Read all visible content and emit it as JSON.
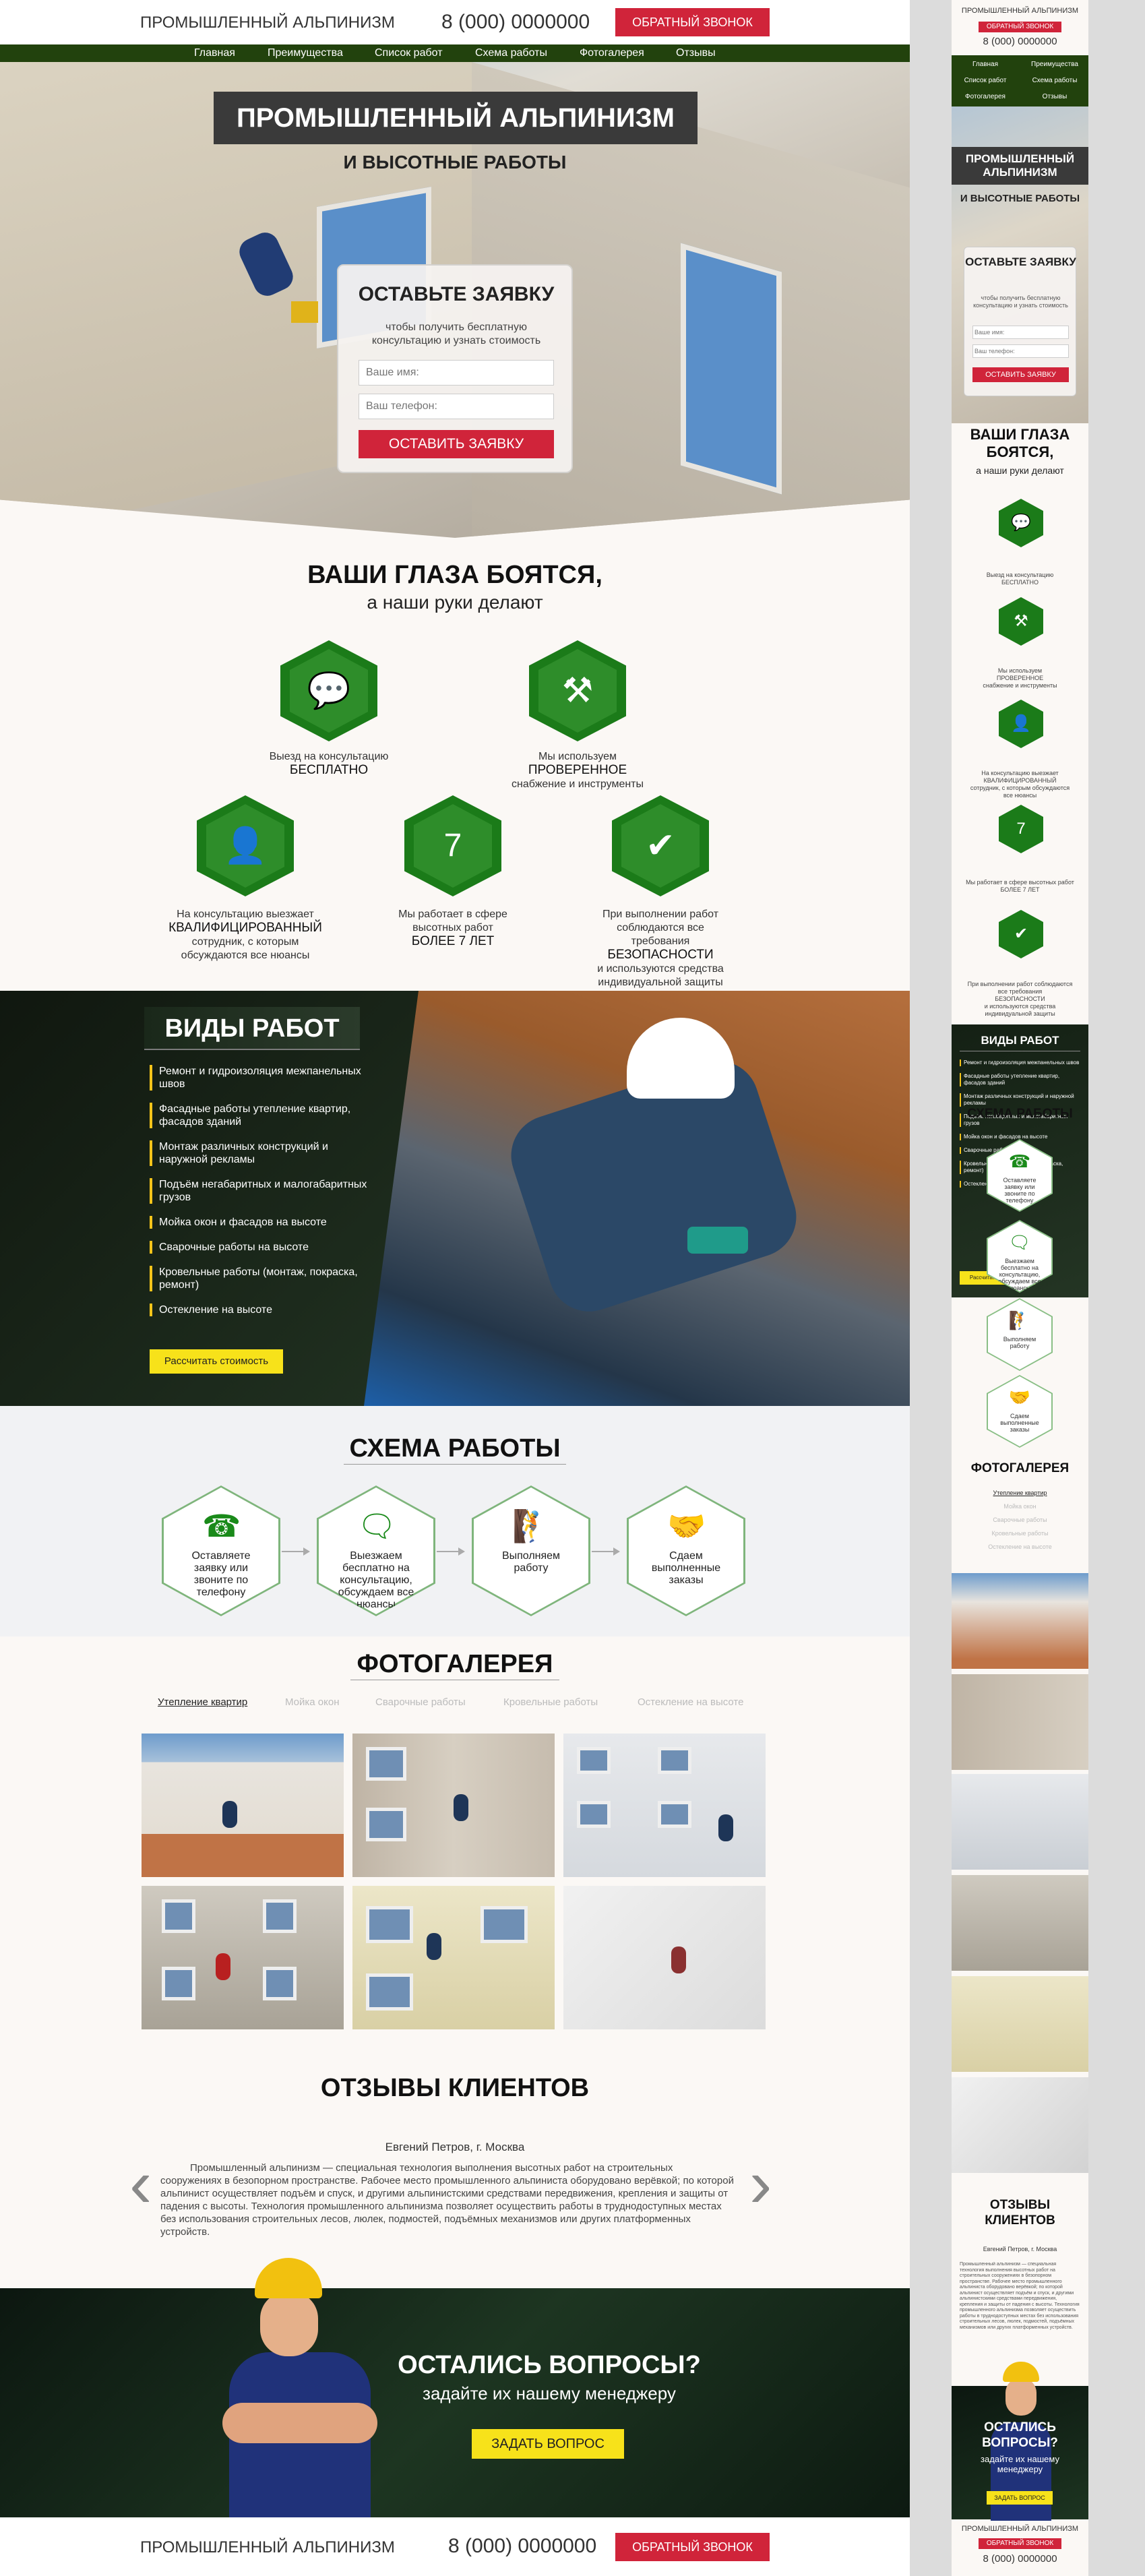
{
  "brand": "ПРОМЫШЛЕННЫЙ АЛЬПИНИЗМ",
  "phone": "8 (000) 0000000",
  "callback_button": "ОБРАТНЫЙ ЗВОНОК",
  "nav": [
    "Главная",
    "Преимущества",
    "Список работ",
    "Схема работы",
    "Фотогалерея",
    "Отзывы"
  ],
  "hero": {
    "title": "ПРОМЫШЛЕННЫЙ АЛЬПИНИЗМ",
    "subtitle": "И ВЫСОТНЫЕ РАБОТЫ",
    "form_title": "ОСТАВЬТЕ ЗАЯВКУ",
    "form_subtitle": "чтобы получить бесплатную консультацию и узнать стоимость",
    "name_placeholder": "Ваше имя:",
    "phone_placeholder": "Ваш телефон:",
    "submit": "ОСТАВИТЬ ЗАЯВКУ"
  },
  "advantages": {
    "title": "ВАШИ ГЛАЗА БОЯТСЯ,",
    "subtitle": "а наши руки делают",
    "items": [
      {
        "icon": "chat-icon",
        "pre": "Выезд на консультацию",
        "bold": "БЕСПЛАТНО",
        "post": ""
      },
      {
        "icon": "jackhammer-icon",
        "pre": "Мы используем",
        "bold": "ПРОВЕРЕННОЕ",
        "post": "снабжение и инструменты"
      },
      {
        "icon": "person-icon",
        "pre": "На консультацию выезжает",
        "bold": "КВАЛИФИЦИРОВАННЫЙ",
        "post": "сотрудник, с которым обсуждаются все нюансы"
      },
      {
        "icon": "seven-icon",
        "number": "7",
        "pre": "Мы работает в сфере высотных работ",
        "bold": "БОЛЕЕ 7 ЛЕТ",
        "post": ""
      },
      {
        "icon": "shield-check-icon",
        "pre": "При выполнении работ соблюдаются все требования",
        "bold": "БЕЗОПАСНОСТИ",
        "post": "и используются средства индивидуальной защиты"
      }
    ]
  },
  "work_types": {
    "title": "ВИДЫ РАБОТ",
    "items": [
      "Ремонт и гидроизоляция межпанельных швов",
      "Фасадные работы утепление квартир, фасадов зданий",
      "Монтаж различных конструкций и наружной рекламы",
      "Подъём негабаритных и малогабаритных грузов",
      "Мойка окон и фасадов на высоте",
      "Сварочные работы на высоте",
      "Кровельные работы (монтаж, покраска, ремонт)",
      "Остекление на высоте"
    ],
    "button": "Рассчитать стоимость"
  },
  "scheme": {
    "title": "СХЕМА РАБОТЫ",
    "steps": [
      {
        "icon": "phone-icon",
        "text": "Оставляете заявку или звоните по телефону"
      },
      {
        "icon": "consultant-icon",
        "text": "Выезжаем бесплатно на консультацию, обсуждаем все нюансы"
      },
      {
        "icon": "climber-icon",
        "text": "Выполняем работу"
      },
      {
        "icon": "handshake-icon",
        "text": "Сдаем выполненные заказы"
      }
    ]
  },
  "gallery": {
    "title": "ФОТОГАЛЕРЕЯ",
    "tabs": [
      "Утепление квартир",
      "Мойка окон",
      "Сварочные работы",
      "Кровельные работы",
      "Остекление на высоте"
    ]
  },
  "reviews": {
    "title": "ОТЗЫВЫ КЛИЕНТОВ",
    "author": "Евгений Петров, г. Москва",
    "text": "Промышленный альпинизм — специальная технология выполнения высотных работ на строительных сооружениях в безопорном пространстве. Рабочее место промышленного альпиниста оборудовано верёвкой; по которой альпинист осуществляет подъём и спуск, и другими альпинистскими средствами передвижения, крепления и защиты от падения с высоты. Технология промышленного альпинизма позволяет осуществить работы в труднодоступных местах без использования строительных лесов, люлек, подмостей, подъёмных механизмов или других платформенных устройств."
  },
  "questions": {
    "title": "ОСТАЛИСЬ ВОПРОСЫ?",
    "subtitle": "задайте их нашему менеджеру",
    "button": "ЗАДАТЬ ВОПРОС"
  }
}
